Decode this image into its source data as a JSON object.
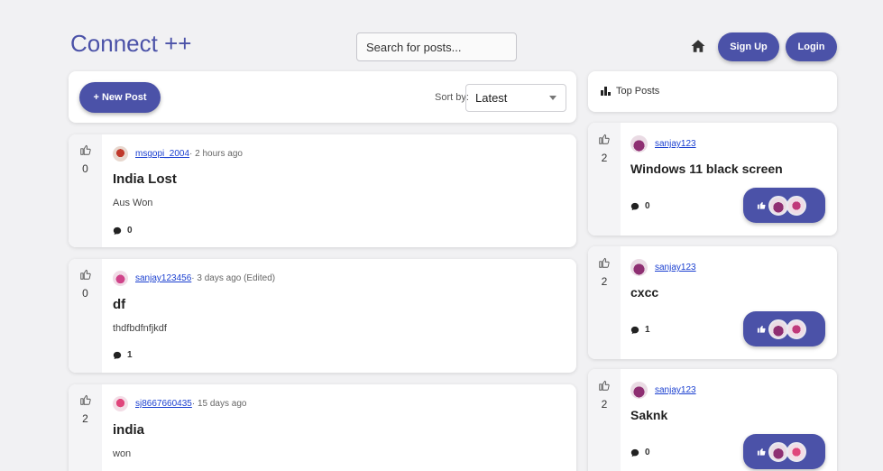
{
  "header": {
    "brand": "Connect ++",
    "search_placeholder": "Search for posts...",
    "signup_label": "Sign Up",
    "login_label": "Login"
  },
  "toolbar": {
    "new_post_label": "+ New Post",
    "sort_label": "Sort by:",
    "sort_value": "Latest"
  },
  "posts": [
    {
      "votes": "0",
      "author": "msgopi_2004",
      "time": " · 2 hours ago",
      "title": "India Lost",
      "body": "Aus Won",
      "comments": "0"
    },
    {
      "votes": "0",
      "author": "sanjay123456",
      "time": " · 3 days ago (Edited)",
      "title": "df",
      "body": "thdfbdfnfjkdf",
      "comments": "1"
    },
    {
      "votes": "2",
      "author": "sj8667660435",
      "time": " · 15 days ago",
      "title": "india",
      "body": "won",
      "comments": ""
    }
  ],
  "top_posts": {
    "header": "Top Posts",
    "items": [
      {
        "votes": "2",
        "author": "sanjay123",
        "title": "Windows 11 black screen",
        "comments": "0"
      },
      {
        "votes": "2",
        "author": "sanjay123",
        "title": "cxcc",
        "comments": "1"
      },
      {
        "votes": "2",
        "author": "sanjay123",
        "title": "Saknk",
        "comments": "0"
      }
    ]
  },
  "colors": {
    "accent": "#4b52a8",
    "link": "#1a3fd0",
    "background": "#f1f1f3"
  },
  "icons": [
    "home-icon",
    "thumbs-up-icon",
    "comment-icon",
    "bar-chart-icon",
    "chevron-down-icon"
  ]
}
